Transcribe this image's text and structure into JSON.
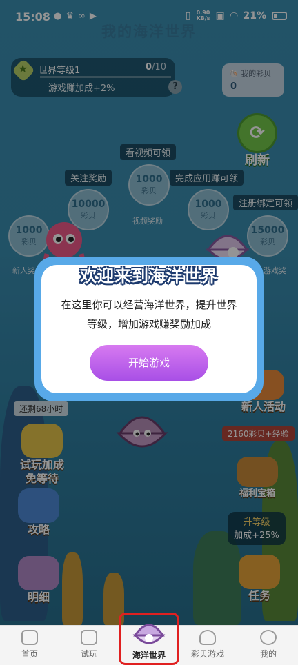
{
  "status_bar": {
    "time": "15:08",
    "network_speed": "0.90",
    "network_unit": "KB/s",
    "battery": "21%"
  },
  "page": {
    "title": "我的海洋世界"
  },
  "level": {
    "name": "世界等级1",
    "current": "0",
    "total": "/10",
    "bonus": "游戏赚加成+2%",
    "help": "?"
  },
  "shells": {
    "label": "我的彩贝",
    "value": "0"
  },
  "refresh": {
    "label": "刷新"
  },
  "tasks": {
    "watch_video": "看视频可领",
    "follow": "关注奖励",
    "complete_app": "完成应用赚可领",
    "register": "注册绑定可领"
  },
  "bubbles": [
    {
      "amount": "1000",
      "unit": "彩贝"
    },
    {
      "amount": "10000",
      "unit": "彩贝"
    },
    {
      "amount": "1000",
      "unit": "彩贝"
    },
    {
      "amount": "1000",
      "unit": "彩贝"
    },
    {
      "amount": "15000",
      "unit": "彩贝"
    }
  ],
  "reward_labels": {
    "video": "视频奖励",
    "newbie": "新人奖",
    "game": "游戏奖"
  },
  "side_buttons": {
    "countdown": "还剩68小时",
    "trial_line1": "试玩加成",
    "trial_line2": "免等待",
    "guide": "攻略",
    "detail": "明细",
    "newbie_event": "新人活动",
    "newbie_reward": "2160彩贝+经验",
    "treasure": "福利宝箱",
    "upgrade_line1": "升等级",
    "upgrade_line2": "加成+25%",
    "tasks": "任务"
  },
  "modal": {
    "title": "欢迎来到海洋世界",
    "text": "在这里你可以经营海洋世界，提升世界等级，增加游戏赚奖励加成",
    "button": "开始游戏"
  },
  "bottom_nav": [
    {
      "label": "首页"
    },
    {
      "label": "试玩"
    },
    {
      "label": "海洋世界"
    },
    {
      "label": "彩贝游戏"
    },
    {
      "label": "我的"
    }
  ]
}
